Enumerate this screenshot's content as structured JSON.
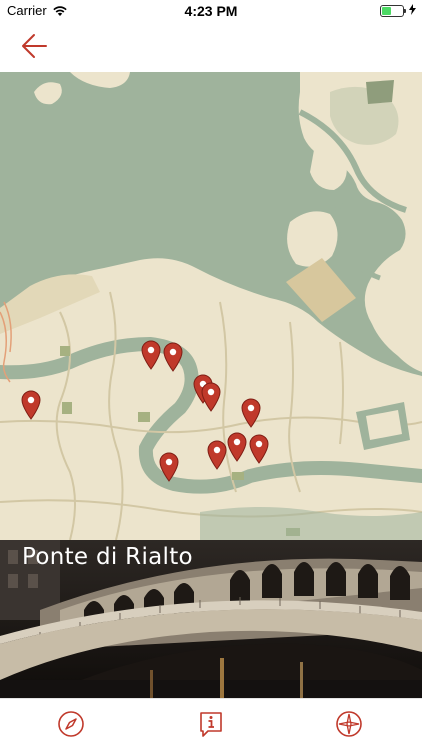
{
  "status_bar": {
    "carrier": "Carrier",
    "time": "4:23 PM",
    "battery_level": 0.5,
    "wifi_icon": "wifi-icon",
    "battery_icon": "battery-icon",
    "charging_icon": "bolt-icon"
  },
  "nav": {
    "back_icon": "arrow-left-icon"
  },
  "map": {
    "pin_count": 11,
    "pin_icon": "map-pin-icon"
  },
  "location": {
    "title": "Ponte di Rialto"
  },
  "tabs": [
    {
      "name": "compass",
      "icon": "compass-icon"
    },
    {
      "name": "info",
      "icon": "info-icon"
    },
    {
      "name": "navigation",
      "icon": "crosshair-compass-icon"
    }
  ],
  "colors": {
    "accent": "#c0392b",
    "water": "#9fb39c",
    "land": "#ece4cc",
    "land_dark": "#d7c79d"
  }
}
